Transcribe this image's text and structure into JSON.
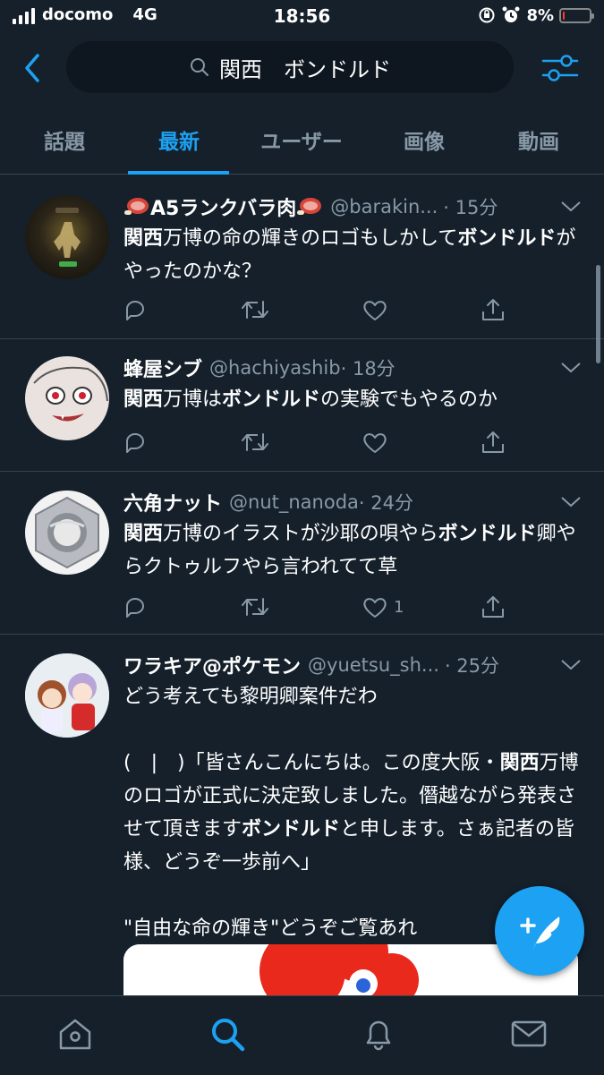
{
  "status_bar": {
    "carrier": "docomo",
    "network": "4G",
    "time": "18:56",
    "battery": "8%",
    "battery_level": 0.08
  },
  "search": {
    "query": "関西　ボンドルド"
  },
  "tabs": [
    {
      "label": "話題",
      "active": false
    },
    {
      "label": "最新",
      "active": true
    },
    {
      "label": "ユーザー",
      "active": false
    },
    {
      "label": "画像",
      "active": false
    },
    {
      "label": "動画",
      "active": false
    }
  ],
  "tweets": [
    {
      "name": "A5ランクバラ肉",
      "handle": "@barakin...",
      "time": "· 15分",
      "text": [
        {
          "t": "関西",
          "b": true
        },
        {
          "t": "万博の命の輝きのロゴもしかして",
          "b": false
        },
        {
          "t": "ボンドルド",
          "b": true
        },
        {
          "t": "がやったのかな？",
          "b": false
        }
      ],
      "like_count": ""
    },
    {
      "name": "蜂屋シブ",
      "handle": "@hachiyashib",
      "time": "· 18分",
      "text": [
        {
          "t": "関西",
          "b": true
        },
        {
          "t": "万博は",
          "b": false
        },
        {
          "t": "ボンドルド",
          "b": true
        },
        {
          "t": "の実験でもやるのか",
          "b": false
        }
      ],
      "like_count": ""
    },
    {
      "name": "六角ナット",
      "handle": "@nut_nanoda",
      "time": "· 24分",
      "text": [
        {
          "t": "関西",
          "b": true
        },
        {
          "t": "万博のイラストが沙耶の唄やら",
          "b": false
        },
        {
          "t": "ボンドルド",
          "b": true
        },
        {
          "t": "卿やらクトゥルフやら言われてて草",
          "b": false
        }
      ],
      "like_count": "1"
    },
    {
      "name": "ワラキア@ポケモン",
      "handle": "@yuetsu_sh...",
      "time": "· 25分",
      "paragraphs": [
        [
          {
            "t": "どう考えても黎明卿案件だわ",
            "b": false
          }
        ],
        [
          {
            "t": "(　|　)「皆さんこんにちは。この度大阪・",
            "b": false
          },
          {
            "t": "関西",
            "b": true
          },
          {
            "t": "万博のロゴが正式に決定致しました。僭越ながら発表させて頂きます",
            "b": false
          },
          {
            "t": "ボンドルド",
            "b": true
          },
          {
            "t": "と申します。さぁ記者の皆様、どうぞ一歩前へ」",
            "b": false
          }
        ],
        [
          {
            "t": "\"自由な命の輝き\"どうぞご覧あれ",
            "b": false
          }
        ]
      ]
    }
  ],
  "icons": {
    "back": "chevron-left-icon",
    "filter": "sliders-icon",
    "search": "search-icon",
    "reply": "reply-icon",
    "retweet": "retweet-icon",
    "like": "heart-icon",
    "share": "share-icon",
    "compose": "compose-icon",
    "home": "home-icon",
    "notifications": "bell-icon",
    "messages": "mail-icon"
  },
  "colors": {
    "background": "#15202b",
    "accent": "#1da1f2",
    "secondary_text": "#8899a6",
    "divider": "#38444d"
  }
}
